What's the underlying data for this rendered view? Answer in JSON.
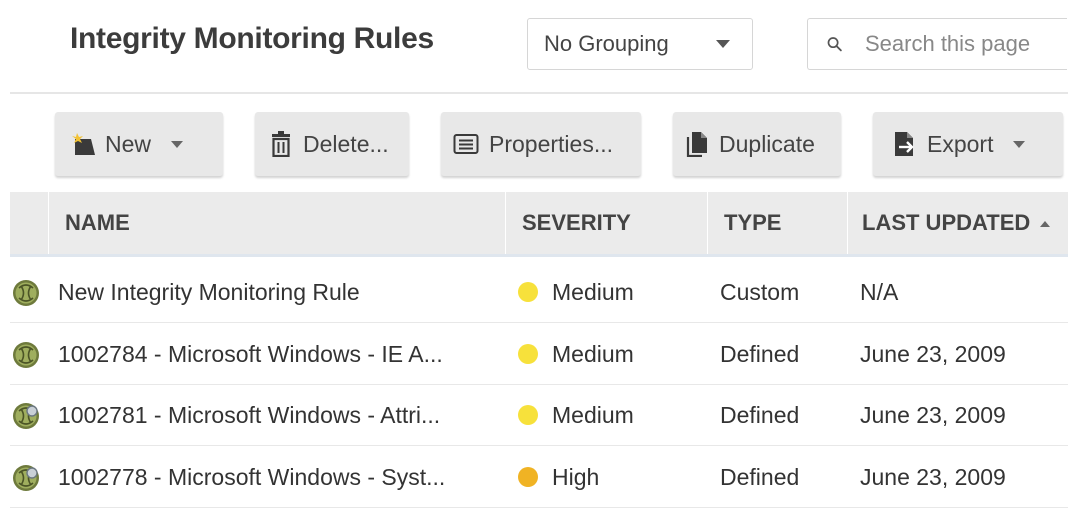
{
  "page": {
    "title": "Integrity Monitoring Rules"
  },
  "grouping": {
    "value": "No Grouping"
  },
  "search": {
    "placeholder": "Search this page"
  },
  "toolbar": {
    "new_label": "New",
    "delete_label": "Delete...",
    "properties_label": "Properties...",
    "duplicate_label": "Duplicate",
    "export_label": "Export"
  },
  "table": {
    "headers": {
      "name": "NAME",
      "severity": "SEVERITY",
      "type": "TYPE",
      "last_updated": "LAST UPDATED"
    },
    "sort": {
      "column": "last_updated",
      "direction": "ascending"
    },
    "rows": [
      {
        "icon": "rule-icon",
        "name": "New Integrity Monitoring Rule",
        "severity": "Medium",
        "severity_color": "#f7e13b",
        "type": "Custom",
        "last_updated": "N/A"
      },
      {
        "icon": "rule-icon",
        "name": "1002784 - Microsoft Windows - IE A...",
        "severity": "Medium",
        "severity_color": "#f7e13b",
        "type": "Defined",
        "last_updated": "June 23, 2009"
      },
      {
        "icon": "rule-config-icon",
        "name": "1002781 - Microsoft Windows - Attri...",
        "severity": "Medium",
        "severity_color": "#f7e13b",
        "type": "Defined",
        "last_updated": "June 23, 2009"
      },
      {
        "icon": "rule-config-icon",
        "name": "1002778 - Microsoft Windows - Syst...",
        "severity": "High",
        "severity_color": "#f0b324",
        "type": "Defined",
        "last_updated": "June 23, 2009"
      }
    ]
  }
}
